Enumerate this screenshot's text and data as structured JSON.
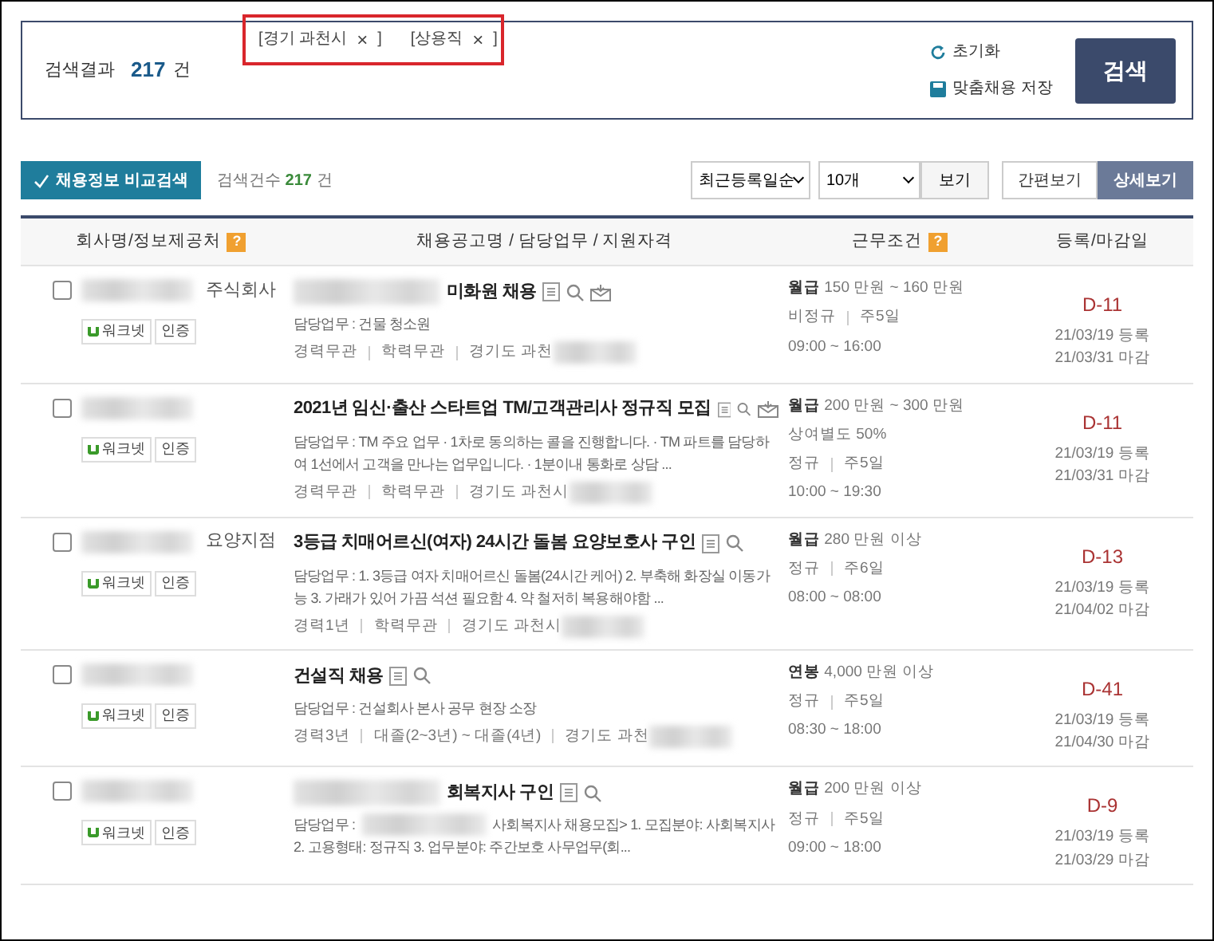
{
  "search_box": {
    "result_label": "검색결과",
    "result_count": "217",
    "result_unit": "건",
    "filters": [
      {
        "label": "[경기 과천시",
        "remove": "×",
        "close": "]"
      },
      {
        "label": "[상용직",
        "remove": "×",
        "close": "]"
      }
    ],
    "reset": "초기화",
    "save": "맞춤채용 저장",
    "search_button": "검색"
  },
  "toolbar": {
    "compare_button": "채용정보 비교검색",
    "count_label": "검색건수",
    "count": "217",
    "count_unit": "건",
    "sort": "최근등록일순",
    "per_page": "10개",
    "view_button": "보기",
    "views": [
      {
        "label": "간편보기",
        "selected": false
      },
      {
        "label": "상세보기",
        "selected": true
      }
    ]
  },
  "table": {
    "columns": [
      {
        "label": "회사명/정보제공처",
        "help": "?"
      },
      {
        "label": "채용공고명 / 담당업무 / 지원자격"
      },
      {
        "label": "근무조건",
        "help": "?"
      },
      {
        "label": "등록/마감일"
      }
    ],
    "rows": [
      {
        "checked": false,
        "company": "주식회사",
        "company_redacted": true,
        "badges": [
          "워크넷",
          "인증"
        ],
        "title": "미화원 채용",
        "title_redacted": true,
        "mail": true,
        "duty": "담당업무 : 건물 청소원",
        "quals": [
          "경력무관",
          "학력무관",
          "경기도 과천"
        ],
        "pay_type": "월급",
        "pay": "150 만원 ~ 160 만원",
        "terms": [
          "비정규",
          "주5일"
        ],
        "hours": "09:00 ~ 16:00",
        "dday": "D-11",
        "registered": "21/03/19 등록",
        "closing": "21/03/31 마감"
      },
      {
        "checked": false,
        "company": "",
        "company_redacted": true,
        "badges": [
          "워크넷",
          "인증"
        ],
        "title": "2021년 임신·출산 스타트업 TM/고객관리사 정규직 모집",
        "title_redacted": false,
        "mail": true,
        "duty": "담당업무 : TM 주요 업무 · 1차로 동의하는 콜을 진행합니다. · TM 파트를 담당하여 1선에서 고객을 만나는 업무입니다. · 1분이내 통화로 상담 ...",
        "quals": [
          "경력무관",
          "학력무관",
          "경기도 과천시"
        ],
        "pay_type": "월급",
        "pay": "200 만원 ~ 300 만원",
        "extra": "상여별도 50%",
        "terms": [
          "정규",
          "주5일"
        ],
        "hours": "10:00 ~ 19:30",
        "dday": "D-11",
        "registered": "21/03/19 등록",
        "closing": "21/03/31 마감"
      },
      {
        "checked": false,
        "company": "요양지점",
        "company_redacted": true,
        "badges": [
          "워크넷",
          "인증"
        ],
        "title": "3등급 치매어르신(여자) 24시간 돌봄 요양보호사 구인",
        "title_redacted": false,
        "mail": false,
        "duty": "담당업무 : 1. 3등급 여자 치매어르신 돌봄(24시간 케어) 2. 부축해 화장실 이동가능 3. 가래가 있어 가끔 석션 필요함 4. 약 철저히 복용해야함 ...",
        "quals": [
          "경력1년",
          "학력무관",
          "경기도 과천시"
        ],
        "pay_type": "월급",
        "pay": "280 만원 이상",
        "terms": [
          "정규",
          "주6일"
        ],
        "hours": "08:00 ~ 08:00",
        "dday": "D-13",
        "registered": "21/03/19 등록",
        "closing": "21/04/02 마감"
      },
      {
        "checked": false,
        "company": "",
        "company_redacted": true,
        "badges": [
          "워크넷",
          "인증"
        ],
        "title": "건설직 채용",
        "title_redacted": false,
        "mail": false,
        "duty": "담당업무 : 건설회사 본사 공무 현장 소장",
        "quals": [
          "경력3년",
          "대졸(2~3년) ~ 대졸(4년)",
          "경기도 과천"
        ],
        "pay_type": "연봉",
        "pay": "4,000 만원 이상",
        "terms": [
          "정규",
          "주5일"
        ],
        "hours": "08:30 ~ 18:00",
        "dday": "D-41",
        "registered": "21/03/19 등록",
        "closing": "21/04/30 마감"
      },
      {
        "checked": false,
        "company": "",
        "company_redacted": true,
        "badges": [
          "워크넷",
          "인증"
        ],
        "title": "회복지사 구인",
        "title_redacted": true,
        "mail": false,
        "duty_prefix": "담당업무 :",
        "duty": "사회복지사 채용모집> 1. 모집분야: 사회복지사",
        "duty_more": "2. 고용형태: 정규직 3. 업무분야: 주간보호 사무업무(회...",
        "pay_type": "월급",
        "pay": "200 만원 이상",
        "terms": [
          "정규",
          "주5일"
        ],
        "hours": "09:00 ~ 18:00",
        "dday": "D-9",
        "registered": "21/03/19 등록",
        "closing": "21/03/29 마감"
      }
    ]
  }
}
